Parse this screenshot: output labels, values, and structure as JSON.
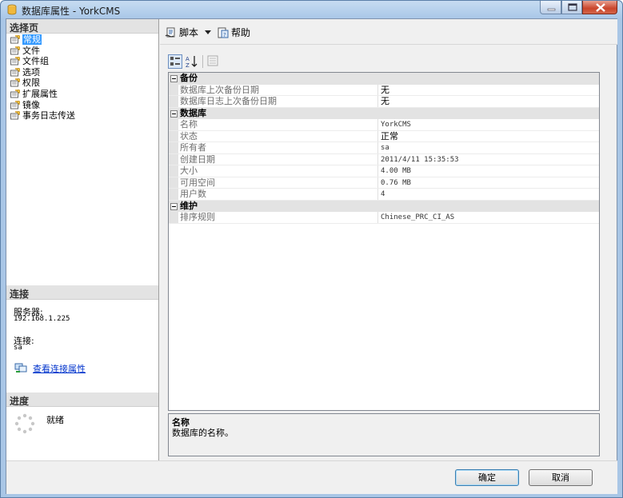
{
  "window": {
    "title": "数据库属性 - YorkCMS"
  },
  "left_panel": {
    "select_page_header": "选择页",
    "pages": [
      {
        "label": "常规",
        "selected": true
      },
      {
        "label": "文件",
        "selected": false
      },
      {
        "label": "文件组",
        "selected": false
      },
      {
        "label": "选项",
        "selected": false
      },
      {
        "label": "权限",
        "selected": false
      },
      {
        "label": "扩展属性",
        "selected": false
      },
      {
        "label": "镜像",
        "selected": false
      },
      {
        "label": "事务日志传送",
        "selected": false
      }
    ],
    "connection_header": "连接",
    "server_label": "服务器:",
    "server_value": "192.168.1.225",
    "connection_label": "连接:",
    "connection_value": "sa",
    "view_connection_link": "查看连接属性",
    "progress_header": "进度",
    "progress_status": "就绪"
  },
  "toolbar": {
    "script_label": "脚本",
    "help_label": "帮助"
  },
  "property_grid": {
    "categories": [
      {
        "name": "备份",
        "rows": [
          {
            "name": "数据库上次备份日期",
            "value": "无"
          },
          {
            "name": "数据库日志上次备份日期",
            "value": "无"
          }
        ]
      },
      {
        "name": "数据库",
        "rows": [
          {
            "name": "名称",
            "value": "YorkCMS"
          },
          {
            "name": "状态",
            "value": "正常"
          },
          {
            "name": "所有者",
            "value": "sa"
          },
          {
            "name": "创建日期",
            "value": "2011/4/11 15:35:53"
          },
          {
            "name": "大小",
            "value": "4.00 MB"
          },
          {
            "name": "可用空间",
            "value": "0.76 MB"
          },
          {
            "name": "用户数",
            "value": "4"
          }
        ]
      },
      {
        "name": "维护",
        "rows": [
          {
            "name": "排序规则",
            "value": "Chinese_PRC_CI_AS"
          }
        ]
      }
    ]
  },
  "description": {
    "title": "名称",
    "text": "数据库的名称。"
  },
  "buttons": {
    "ok": "确定",
    "cancel": "取消"
  },
  "colors": {
    "selection": "#3399ff",
    "link": "#0033cc",
    "category_bg": "#e3e3e3"
  }
}
